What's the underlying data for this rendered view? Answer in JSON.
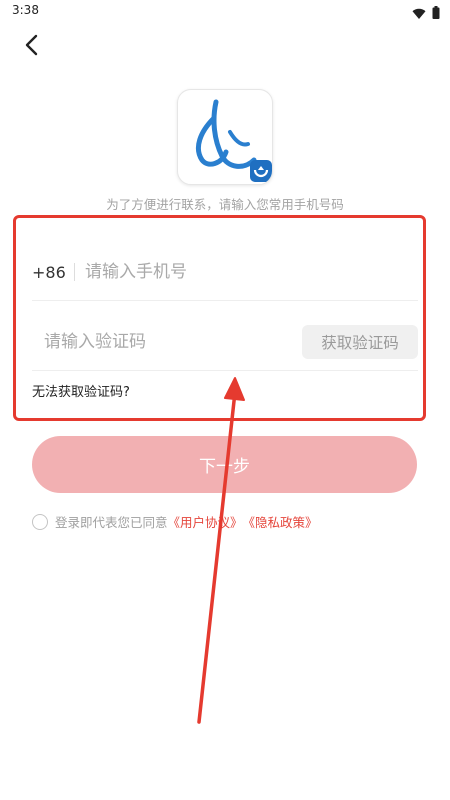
{
  "status_bar": {
    "time": "3:38"
  },
  "header": {
    "back_icon": "chevron-left-icon"
  },
  "logo": {
    "icon": "app-logo-icon",
    "colors": {
      "primary": "#2a7fcf",
      "badge": "#1f6fc1"
    }
  },
  "subtitle": "为了方便进行联系，请输入您常用手机号码",
  "form": {
    "country_code": "+86",
    "phone_placeholder": "请输入手机号",
    "code_placeholder": "请输入验证码",
    "get_code_label": "获取验证码",
    "cant_get_code": "无法获取验证码?"
  },
  "next_button_label": "下一步",
  "agreement": {
    "prefix": "登录即代表您已同意",
    "user_agreement": "《用户协议》",
    "privacy_policy": "《隐私政策》"
  },
  "colors": {
    "accent": "#e5463c",
    "highlight_border": "#e53a2f",
    "next_button": "#f2b0b2"
  }
}
